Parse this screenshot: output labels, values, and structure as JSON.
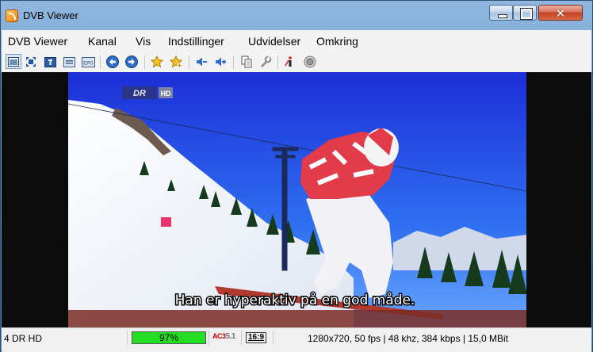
{
  "window": {
    "title": "DVB Viewer",
    "controls": {
      "minimize": "minimize",
      "maximize": "maximize",
      "close": "close"
    }
  },
  "menu": {
    "items": [
      {
        "label": "DVB Viewer"
      },
      {
        "label": "Kanal"
      },
      {
        "label": "Vis"
      },
      {
        "label": "Indstillinger"
      },
      {
        "label": "Udvidelser"
      },
      {
        "label": "Omkring"
      }
    ]
  },
  "toolbar": {
    "buttons": [
      {
        "icon": "window-mode-icon",
        "selected": true
      },
      {
        "icon": "fullscreen-icon"
      },
      {
        "icon": "teletext-icon"
      },
      {
        "icon": "osd-icon"
      },
      {
        "icon": "epg-icon",
        "text": "EPG"
      },
      {
        "icon": "back-arrow-icon"
      },
      {
        "icon": "forward-arrow-icon"
      },
      {
        "icon": "favorites-star-icon"
      },
      {
        "icon": "add-favorite-star-icon"
      },
      {
        "icon": "volume-down-icon"
      },
      {
        "icon": "volume-up-icon"
      },
      {
        "icon": "copy-icon"
      },
      {
        "icon": "settings-wrench-icon"
      },
      {
        "icon": "info-icon"
      },
      {
        "icon": "record-icon"
      }
    ]
  },
  "video": {
    "channel_logo": "DR",
    "channel_logo_badge": "HD",
    "subtitle": "Han er hyperaktiv på en god måde."
  },
  "status": {
    "channel": "4 DR HD",
    "signal": "97%",
    "signal_fraction": 0.97,
    "audio_badge": "AC3",
    "audio_channels": "5.1",
    "aspect": "16:9",
    "stream_info": "1280x720, 50 fps | 48 khz, 384 kbps | 15,0 MBit"
  },
  "colors": {
    "signal_bar": "#22dd22",
    "titlebar": "#7fa9d3",
    "close_button": "#c4411f"
  }
}
